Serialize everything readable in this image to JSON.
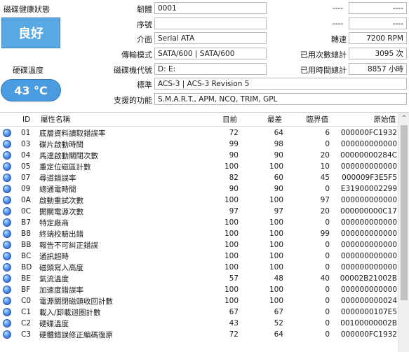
{
  "status": {
    "health_label": "磁碟健康狀態",
    "health_value": "良好",
    "temp_label": "硬碟溫度",
    "temp_value": "43 °C",
    "health_color": "#59a8e3",
    "temp_color": "#4a9be0"
  },
  "info": {
    "firmware_label": "韌體",
    "firmware_value": "0001",
    "serial_label": "序號",
    "serial_value": "",
    "interface_label": "介面",
    "interface_value": "Serial ATA",
    "transfer_label": "傳輸模式",
    "transfer_value": "SATA/600 | SATA/600",
    "drive_letter_label": "磁碟機代號",
    "drive_letter_value": "D: E:",
    "standard_label": "標準",
    "standard_value": "ACS-3 | ACS-3 Revision 5",
    "features_label": "支援的功能",
    "features_value": "S.M.A.R.T., APM, NCQ, TRIM, GPL",
    "right_top1_a": "----",
    "right_top1_b": "----",
    "right_top2_a": "----",
    "right_top2_b": "----",
    "rotation_label": "轉速",
    "rotation_value": "7200 RPM",
    "power_on_count_label": "已用次數總計",
    "power_on_count_value": "3095 次",
    "power_on_hours_label": "已用時間總計",
    "power_on_hours_value": "8857 小時"
  },
  "table": {
    "headers": {
      "id": "ID",
      "name": "屬性名稱",
      "current": "目前",
      "worst": "最差",
      "threshold": "臨界值",
      "raw": "原始值",
      "sort_icon": "^"
    },
    "rows": [
      {
        "id": "01",
        "name": "底層資料讀取錯誤率",
        "current": "72",
        "worst": "64",
        "threshold": "6",
        "raw": "000000FC1932"
      },
      {
        "id": "03",
        "name": "碟片啟動時間",
        "current": "99",
        "worst": "98",
        "threshold": "0",
        "raw": "000000000000"
      },
      {
        "id": "04",
        "name": "馬達啟動關閉次數",
        "current": "90",
        "worst": "90",
        "threshold": "20",
        "raw": "00000000284C"
      },
      {
        "id": "05",
        "name": "重定位磁區計數",
        "current": "100",
        "worst": "100",
        "threshold": "10",
        "raw": "000000000000"
      },
      {
        "id": "07",
        "name": "尋道錯誤率",
        "current": "82",
        "worst": "60",
        "threshold": "45",
        "raw": "000009F3E5F5"
      },
      {
        "id": "09",
        "name": "總通電時間",
        "current": "90",
        "worst": "90",
        "threshold": "0",
        "raw": "E31900002299"
      },
      {
        "id": "0A",
        "name": "啟動重試次數",
        "current": "100",
        "worst": "100",
        "threshold": "97",
        "raw": "000000000000"
      },
      {
        "id": "0C",
        "name": "開關電源次數",
        "current": "97",
        "worst": "97",
        "threshold": "20",
        "raw": "000000000C17"
      },
      {
        "id": "B7",
        "name": "特定廠商",
        "current": "100",
        "worst": "100",
        "threshold": "0",
        "raw": "000000000000"
      },
      {
        "id": "B8",
        "name": "終端校驗出錯",
        "current": "100",
        "worst": "100",
        "threshold": "99",
        "raw": "000000000000"
      },
      {
        "id": "BB",
        "name": "報告不可糾正錯誤",
        "current": "100",
        "worst": "100",
        "threshold": "0",
        "raw": "000000000000"
      },
      {
        "id": "BC",
        "name": "通訊超時",
        "current": "100",
        "worst": "100",
        "threshold": "0",
        "raw": "000000000000"
      },
      {
        "id": "BD",
        "name": "磁頭寫入高度",
        "current": "100",
        "worst": "100",
        "threshold": "0",
        "raw": "000000000000"
      },
      {
        "id": "BE",
        "name": "氣流溫度",
        "current": "57",
        "worst": "48",
        "threshold": "40",
        "raw": "00002B21002B"
      },
      {
        "id": "BF",
        "name": "加速度錯誤率",
        "current": "100",
        "worst": "100",
        "threshold": "0",
        "raw": "000000000000"
      },
      {
        "id": "C0",
        "name": "電源關閉磁頭收回計數",
        "current": "100",
        "worst": "100",
        "threshold": "0",
        "raw": "000000000024"
      },
      {
        "id": "C1",
        "name": "載入/卸載迴圈計數",
        "current": "67",
        "worst": "67",
        "threshold": "0",
        "raw": "0000000107E5"
      },
      {
        "id": "C2",
        "name": "硬碟溫度",
        "current": "43",
        "worst": "52",
        "threshold": "0",
        "raw": "00100000002B"
      },
      {
        "id": "C3",
        "name": "硬體錯誤修正編碼復原",
        "current": "72",
        "worst": "64",
        "threshold": "0",
        "raw": "000000FC1932"
      }
    ]
  }
}
